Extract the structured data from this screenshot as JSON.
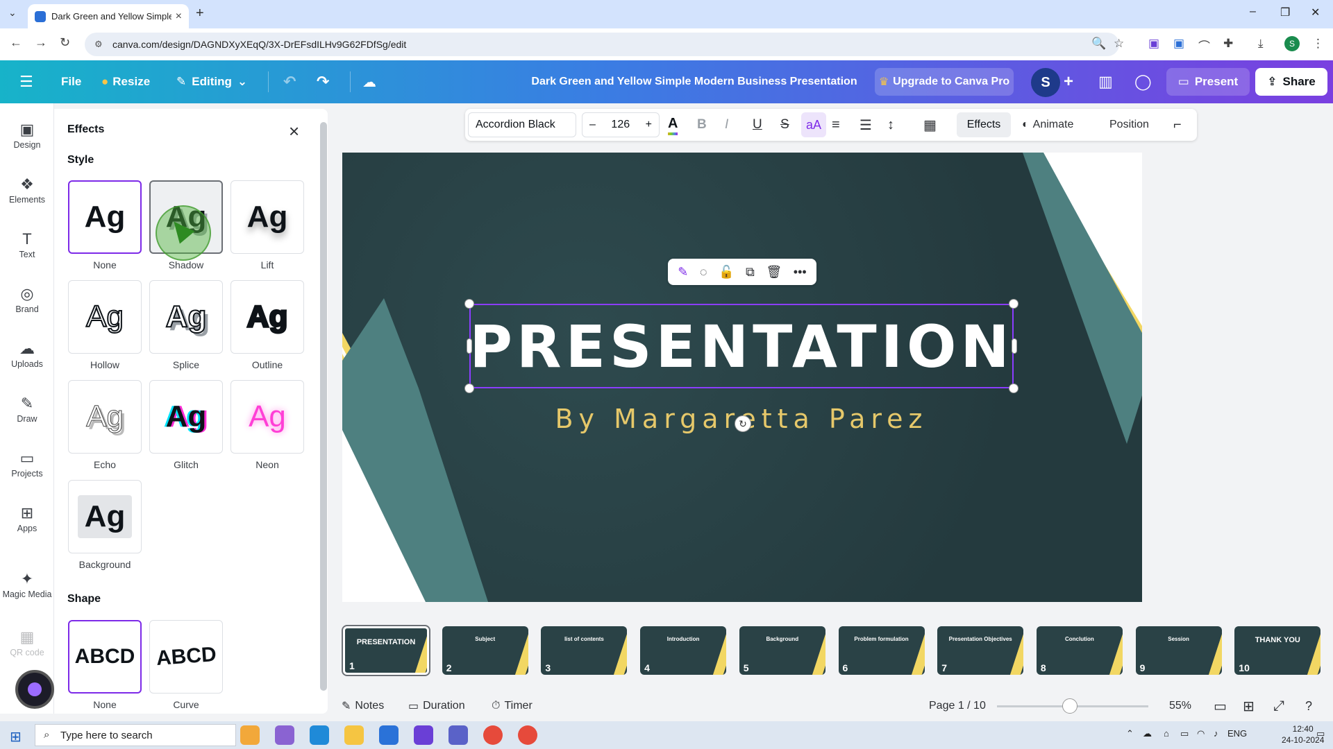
{
  "browser": {
    "tab_title": "Dark Green and Yellow Simple I",
    "url": "canva.com/design/DAGNDXyXEqQ/3X-DrEFsdILHv9G62FDfSg/edit"
  },
  "header": {
    "file": "File",
    "resize": "Resize",
    "editing": "Editing",
    "doc_title": "Dark Green and Yellow Simple Modern Business Presentation",
    "upgrade": "Upgrade to Canva Pro",
    "avatar": "S",
    "present": "Present",
    "share": "Share"
  },
  "rail": [
    {
      "label": "Design",
      "icon": "design-icon",
      "glyph": "▣"
    },
    {
      "label": "Elements",
      "icon": "elements-icon",
      "glyph": "❖"
    },
    {
      "label": "Text",
      "icon": "text-icon",
      "glyph": "T"
    },
    {
      "label": "Brand",
      "icon": "brand-icon",
      "glyph": "◎"
    },
    {
      "label": "Uploads",
      "icon": "uploads-icon",
      "glyph": "☁"
    },
    {
      "label": "Draw",
      "icon": "draw-icon",
      "glyph": "✎"
    },
    {
      "label": "Projects",
      "icon": "projects-icon",
      "glyph": "▭"
    },
    {
      "label": "Apps",
      "icon": "apps-icon",
      "glyph": "⊞"
    },
    {
      "label": "Magic Media",
      "icon": "magic-media-icon",
      "glyph": "✦"
    },
    {
      "label": "QR code",
      "icon": "qr-code-icon",
      "glyph": "▦"
    }
  ],
  "panel": {
    "title": "Effects",
    "style_heading": "Style",
    "shape_heading": "Shape",
    "styles": [
      {
        "label": "None",
        "sample": "Ag"
      },
      {
        "label": "Shadow",
        "sample": "Ag"
      },
      {
        "label": "Lift",
        "sample": "Ag"
      },
      {
        "label": "Hollow",
        "sample": "Ag"
      },
      {
        "label": "Splice",
        "sample": "Ag"
      },
      {
        "label": "Outline",
        "sample": "Ag"
      },
      {
        "label": "Echo",
        "sample": "Ag"
      },
      {
        "label": "Glitch",
        "sample": "Ag"
      },
      {
        "label": "Neon",
        "sample": "Ag"
      },
      {
        "label": "Background",
        "sample": "Ag"
      }
    ],
    "shapes": [
      {
        "label": "None",
        "sample": "ABCD"
      },
      {
        "label": "Curve",
        "sample": "ABCD"
      }
    ]
  },
  "toolbar": {
    "font": "Accordion Black",
    "size": "126",
    "effects": "Effects",
    "animate": "Animate",
    "position": "Position"
  },
  "slide": {
    "headline": "PRESENTATION",
    "byline": "By Margaretta Parez"
  },
  "thumbnails": [
    {
      "n": "1",
      "title": "PRESENTATION"
    },
    {
      "n": "2",
      "title": "Subject"
    },
    {
      "n": "3",
      "title": "list of contents"
    },
    {
      "n": "4",
      "title": "Introduction"
    },
    {
      "n": "5",
      "title": "Background"
    },
    {
      "n": "6",
      "title": "Problem formulation"
    },
    {
      "n": "7",
      "title": "Presentation Objectives"
    },
    {
      "n": "8",
      "title": "Conclution"
    },
    {
      "n": "9",
      "title": "Session"
    },
    {
      "n": "10",
      "title": "THANK YOU"
    }
  ],
  "footer": {
    "notes": "Notes",
    "duration": "Duration",
    "timer": "Timer",
    "page": "Page 1 / 10",
    "zoom": "55%",
    "zoom_fraction": 0.48
  },
  "taskbar": {
    "search_placeholder": "Type here to search",
    "lang": "ENG",
    "time": "12:40",
    "date": "24-10-2024"
  },
  "colors": {
    "accent": "#7d2ae8",
    "slide_bg": "#273f43",
    "slide_yellow": "#f2d763",
    "slide_teal": "#4e8080",
    "byline": "#e6c86a"
  }
}
